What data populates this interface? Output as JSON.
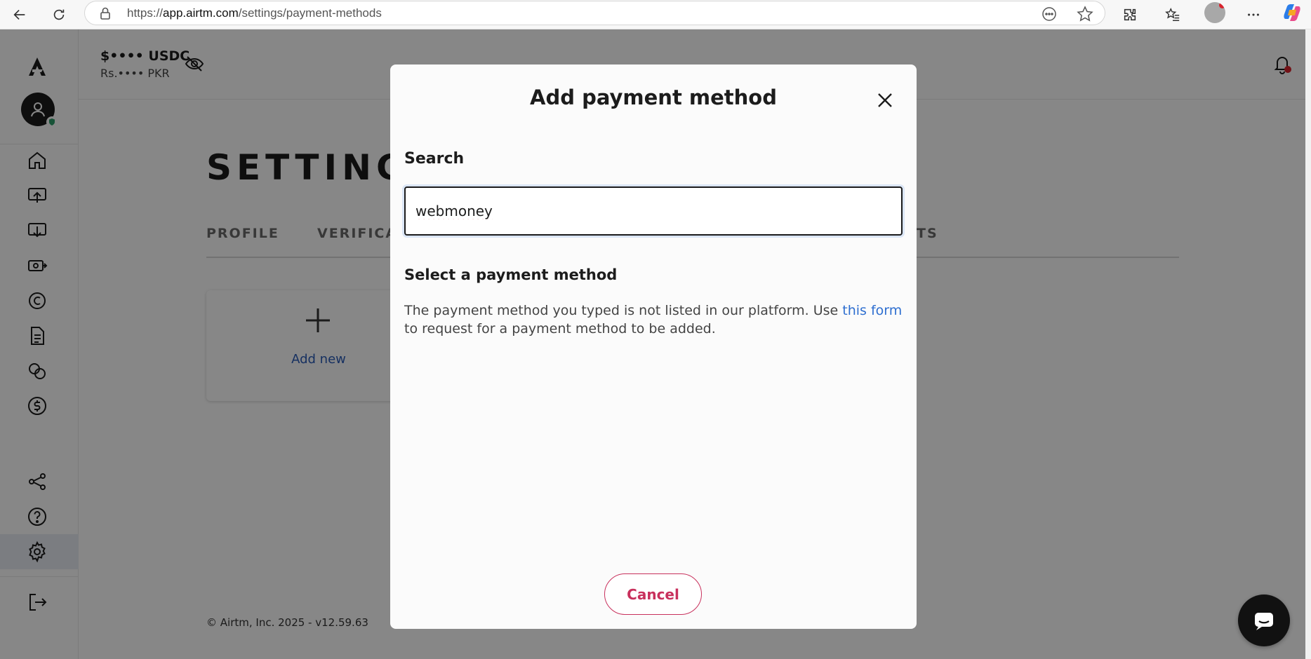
{
  "browser": {
    "url_prefix": "https://",
    "url_host": "app.airtm.com",
    "url_path": "/settings/payment-methods"
  },
  "topbar": {
    "balance_primary": "$•••• USDC",
    "balance_secondary": "Rs.•••• PKR"
  },
  "page": {
    "title": "SETTINGS",
    "tabs": [
      {
        "label": "PROFILE"
      },
      {
        "label": "VERIFICA"
      },
      {
        "label": "TS"
      }
    ],
    "add_new_label": "Add new",
    "footer": "© Airtm, Inc. 2025 - v12.59.63"
  },
  "modal": {
    "title": "Add payment method",
    "search_label": "Search",
    "search_value": "webmoney",
    "select_label": "Select a payment method",
    "info_prefix": "The payment method you typed is not listed in our platform. Use ",
    "info_link": "this form",
    "info_suffix": " to request for a payment method to be added.",
    "cancel_label": "Cancel"
  },
  "colors": {
    "accent_link": "#2f6fd0",
    "cancel": "#c8305c",
    "notification": "#d9232d"
  }
}
